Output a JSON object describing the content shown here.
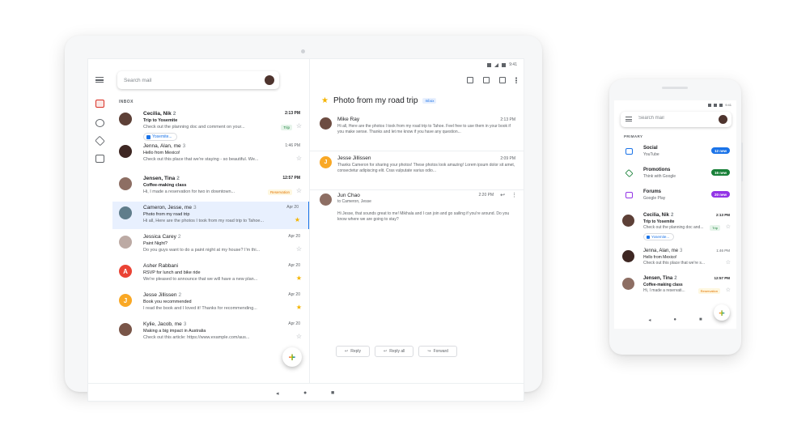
{
  "tablet": {
    "status": {
      "time": "9:41"
    },
    "search": {
      "placeholder": "Search mail"
    },
    "section_label": "INBOX",
    "list": [
      {
        "sender": "Cecilia, Nik",
        "count": "2",
        "subject": "Trip to Yosemite",
        "snippet": "Check out the planning doc and comment on your...",
        "time": "2:13 PM",
        "tag": "Trip",
        "chip": "Yosemite...",
        "starred": false,
        "unread": true,
        "avatar_color": "#5d4037",
        "initial": ""
      },
      {
        "sender": "Jenna, Alan, me",
        "count": "3",
        "subject": "Hello from Mexico!",
        "snippet": "Check out this place that we're staying - so beautiful. We...",
        "time": "1:46 PM",
        "starred": false,
        "unread": false,
        "avatar_color": "#3e2723",
        "initial": ""
      },
      {
        "sender": "Jensen, Tina",
        "count": "2",
        "subject": "Coffee-making class",
        "snippet": "Hi, I made a reservation for two in downtown...",
        "time": "12:57 PM",
        "tag": "Reservation",
        "starred": false,
        "unread": true,
        "avatar_color": "#8d6e63",
        "initial": ""
      },
      {
        "sender": "Cameron, Jesse, me",
        "count": "3",
        "subject": "Photo from my road trip",
        "snippet": "Hi all, Here are the photos I took from my road trip to Tahoe...",
        "time": "Apr 20",
        "starred": true,
        "unread": false,
        "selected": true,
        "avatar_color": "#607d8b",
        "initial": ""
      },
      {
        "sender": "Jessica Carey",
        "count": "2",
        "subject": "Paint Night?",
        "snippet": "Do you guys want to do a paint night at my house? I'm thi...",
        "time": "Apr 20",
        "starred": false,
        "unread": false,
        "avatar_color": "#bcaaa4",
        "initial": ""
      },
      {
        "sender": "Asher Rabbani",
        "count": "",
        "subject": "RSVP for lunch and bike ride",
        "snippet": "We're pleased to announce that we will have a new plan...",
        "time": "Apr 20",
        "starred": true,
        "unread": false,
        "avatar_color": "#ea4335",
        "initial": "A"
      },
      {
        "sender": "Jesse Jillissen",
        "count": "2",
        "subject": "Book you recommended",
        "snippet": "I read the book and I loved it! Thanks for recommending...",
        "time": "Apr 20",
        "starred": true,
        "unread": false,
        "avatar_color": "#f9a825",
        "initial": "J"
      },
      {
        "sender": "Kylie, Jacob, me",
        "count": "3",
        "subject": "Making a big impact in Australia",
        "snippet": "Check out this article: https://www.example.com/aus...",
        "time": "Apr 20",
        "starred": false,
        "unread": false,
        "avatar_color": "#795548",
        "initial": ""
      }
    ],
    "reader": {
      "subject": "Photo from my road trip",
      "label": "Inbox",
      "messages": [
        {
          "from": "Mike Ray",
          "body": "Hi all, Here are the photos I took from my road trip to Tahoe. Feel free to use them in your book if you make sense. Thanks and let me know if you have any question...",
          "time": "2:13 PM",
          "avatar_color": "#6d4c41",
          "initial": ""
        },
        {
          "from": "Jesse Jillissen",
          "body": "Thanks Cameron for sharing your photos! These photos look amazing! Lorem ipsum dolor sit amet, consectetur adipiscing elit. Cras vulputate varius odio...",
          "time": "2:09 PM",
          "avatar_color": "#f9a825",
          "initial": "J"
        },
        {
          "from": "Jun Chao",
          "to": "to Cameron, Jesse",
          "body": "Hi Jesse, that sounds great to me! Mikhala and I can join and go sailing if you're around. Do you know where we are going to stay?",
          "time": "2:20 PM",
          "avatar_color": "#8d6e63",
          "initial": ""
        }
      ],
      "reply": "Reply",
      "reply_all": "Reply all",
      "forward": "Forward"
    }
  },
  "phone": {
    "status": {
      "time": "9:41"
    },
    "search": {
      "placeholder": "Search mail"
    },
    "section_label": "PRIMARY",
    "categories": [
      {
        "title": "Social",
        "sub": "YouTube",
        "badge": "12 new",
        "color": "#1a73e8"
      },
      {
        "title": "Promotions",
        "sub": "Think with Google",
        "badge": "16 new",
        "color": "#188038"
      },
      {
        "title": "Forums",
        "sub": "Google Play",
        "badge": "20 new",
        "color": "#9334e6"
      }
    ],
    "list": [
      {
        "sender": "Cecilia, Nik",
        "count": "2",
        "subject": "Trip to Yosemite",
        "snippet": "Check out the planning doc and...",
        "time": "2:13 PM",
        "tag": "Trip",
        "chip": "Yosemite...",
        "unread": true,
        "avatar_color": "#5d4037"
      },
      {
        "sender": "Jenna, Alan, me",
        "count": "3",
        "subject": "Hello from Mexico!",
        "snippet": "Check out this place that we're s...",
        "time": "1:46 PM",
        "unread": false,
        "avatar_color": "#3e2723"
      },
      {
        "sender": "Jensen, Tina",
        "count": "2",
        "subject": "Coffee-making class",
        "snippet": "Hi, I made a reservati...",
        "time": "12:57 PM",
        "tag": "Reservation",
        "unread": true,
        "avatar_color": "#8d6e63"
      }
    ]
  },
  "colors": {
    "accent": "#1a73e8",
    "star": "#f4b400",
    "selected_bg": "#e8f0fe"
  }
}
